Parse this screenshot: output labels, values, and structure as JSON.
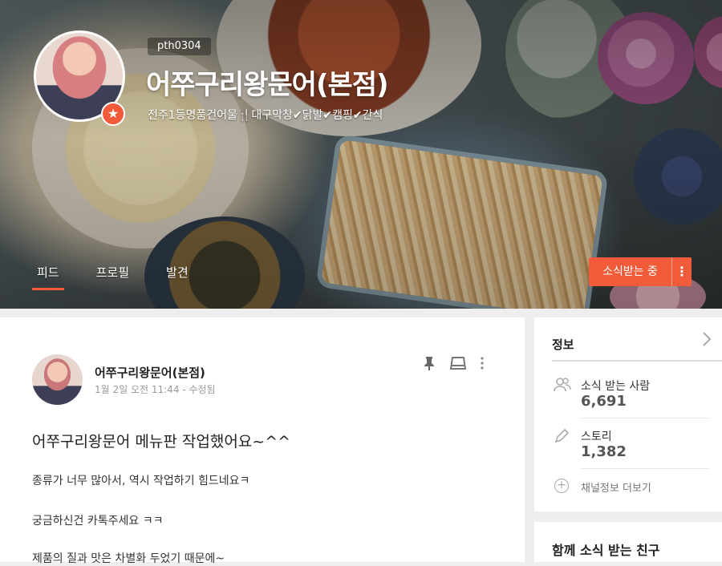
{
  "header": {
    "user_id": "pth0304",
    "channel_name": "어쭈구리왕문어(본점)",
    "description": "전주1등명품건어물🍴대구막창✔닭발✔캠핑✔간식",
    "tabs": [
      "피드",
      "프로필",
      "발견"
    ],
    "subscribe_label": "소식받는 중",
    "more_label": "⋮"
  },
  "post": {
    "author": "어쭈구리왕문어(본점)",
    "meta": "1월 2일 오전 11:44 - 수정됨",
    "title": "어쭈구리왕문어 메뉴판 작업했어요~^^",
    "lines": [
      "종류가 너무 많아서, 역시 작업하기 힘드네요ㅋ",
      "궁금하신건 카톡주세요  ㅋㅋ",
      "제품의 질과 맛은 차별화 두었기 때문에~"
    ]
  },
  "info": {
    "title": "정보",
    "subscribers_label": "소식 받는 사람",
    "subscribers_value": "6,691",
    "stories_label": "스토리",
    "stories_value": "1,382",
    "more_link": "채널정보 더보기"
  },
  "friends": {
    "title": "함께 소식 받는 친구"
  },
  "colors": {
    "accent": "#f15b3a"
  }
}
